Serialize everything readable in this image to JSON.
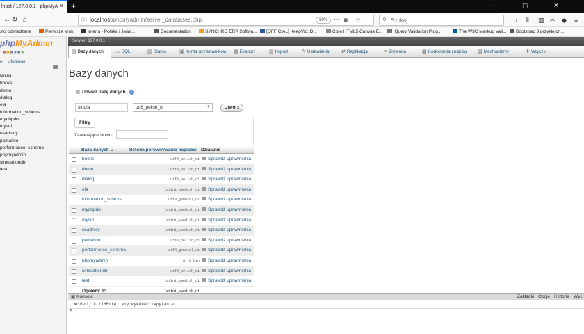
{
  "browser": {
    "tab_title": "lhost / 127.0.0.1 | phpMyA",
    "url_prefix": "localhost",
    "url_path": "/phpmyadmin/server_databases.php",
    "zoom": "90%",
    "search_placeholder": "Szukaj"
  },
  "bookmarks": [
    {
      "label": "sto odwiedzane",
      "color": "#e8e8e8"
    },
    {
      "label": "Pierwsze kroki",
      "color": "#e66000"
    },
    {
      "label": "Interia - Polska i świat...",
      "color": "#333333"
    },
    {
      "label": "Documentation",
      "color": "#555555"
    },
    {
      "label": "SYNCHRO ERP Softwa...",
      "color": "#f0a020"
    },
    {
      "label": "[OFFICIAL] KeepVid: D...",
      "color": "#2b5797"
    },
    {
      "label": "Core HTML5 Canvas E...",
      "color": "#888888"
    },
    {
      "label": "jQuery Validation Plug...",
      "color": "#777777"
    },
    {
      "label": "The W3C Markup Vali...",
      "color": "#005a9c"
    },
    {
      "label": "Bootstrap 3 przykłejon...",
      "color": "#555555"
    }
  ],
  "sidebar": {
    "logo_php": "php",
    "logo_myadmin": "MyAdmin",
    "recent": "e",
    "favorites": "Ulubione",
    "tree": [
      "Nowa",
      "books",
      "demo",
      "dialog",
      "ela",
      "information_schema",
      "mydbpdo",
      "mysql",
      "osadnicy",
      "pamalino",
      "performance_schema",
      "phpmyadmin",
      "simulationdb",
      "test"
    ]
  },
  "topbar": {
    "server": "Serwer: 127.0.0.1"
  },
  "menu": [
    {
      "label": "Bazy danych",
      "icon": "db-icon"
    },
    {
      "label": "SQL",
      "icon": "sql-icon"
    },
    {
      "label": "Status",
      "icon": "status-icon"
    },
    {
      "label": "Konta użytkowników",
      "icon": "users-icon"
    },
    {
      "label": "Eksport",
      "icon": "export-icon"
    },
    {
      "label": "Import",
      "icon": "import-icon"
    },
    {
      "label": "Ustawienia",
      "icon": "settings-icon"
    },
    {
      "label": "Replikacja",
      "icon": "replication-icon"
    },
    {
      "label": "Zmienne",
      "icon": "variables-icon"
    },
    {
      "label": "Kodowania znaków",
      "icon": "charset-icon"
    },
    {
      "label": "Mechanizmy",
      "icon": "engines-icon"
    },
    {
      "label": "Wtyczki",
      "icon": "plugins-icon"
    }
  ],
  "main": {
    "title": "Bazy danych",
    "create_label": "Utwórz bazę danych",
    "dbname_value": "studia",
    "collation_value": "utf8_polish_ci",
    "create_button": "Utwórz",
    "filters_title": "Filtry",
    "filter_label": "Zawierające słowo:",
    "filter_value": ""
  },
  "table": {
    "headers": {
      "name": "Baza danych",
      "sort": "▲",
      "collation": "Metoda porównywania napisów",
      "action": "Działanie"
    },
    "rows": [
      {
        "name": "books",
        "collation": "utf8_polish_ci",
        "action": "Sprawdź uprawnienia",
        "system": false
      },
      {
        "name": "demo",
        "collation": "utf8_polish_ci",
        "action": "Sprawdź uprawnienia",
        "system": false
      },
      {
        "name": "dialog",
        "collation": "utf8_polish_ci",
        "action": "Sprawdź uprawnienia",
        "system": false
      },
      {
        "name": "ela",
        "collation": "latin1_swedish_ci",
        "action": "Sprawdź uprawnienia",
        "system": false
      },
      {
        "name": "information_schema",
        "collation": "utf8_general_ci",
        "action": "Sprawdź uprawnienia",
        "system": true
      },
      {
        "name": "mydbpdo",
        "collation": "latin1_swedish_ci",
        "action": "Sprawdź uprawnienia",
        "system": false
      },
      {
        "name": "mysql",
        "collation": "latin1_swedish_ci",
        "action": "Sprawdź uprawnienia",
        "system": true
      },
      {
        "name": "osadnicy",
        "collation": "latin1_swedish_ci",
        "action": "Sprawdź uprawnienia",
        "system": false
      },
      {
        "name": "pamalino",
        "collation": "utf8_polish_ci",
        "action": "Sprawdź uprawnienia",
        "system": false
      },
      {
        "name": "performance_schema",
        "collation": "utf8_general_ci",
        "action": "Sprawdź uprawnienia",
        "system": true
      },
      {
        "name": "phpmyadmin",
        "collation": "utf8_bin",
        "action": "Sprawdź uprawnienia",
        "system": false
      },
      {
        "name": "simulationdb",
        "collation": "utf8_polish_ci",
        "action": "Sprawdź uprawnienia",
        "system": false
      },
      {
        "name": "test",
        "collation": "latin1_swedish_ci",
        "action": "Sprawdź uprawnienia",
        "system": false
      }
    ],
    "total_label": "Ogółem: 13",
    "total_collation": "latin1_swedish_ci"
  },
  "console": {
    "title": "Konsola",
    "options": [
      "Zakładki",
      "Opcje",
      "Historia",
      "Wyc"
    ],
    "hint": "Wciśnij Ctrl+Enter aby wykonać zapytanie",
    "prompt": ">"
  }
}
